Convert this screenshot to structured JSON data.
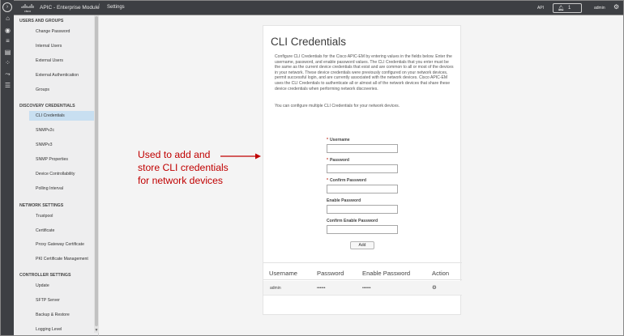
{
  "topbar": {
    "brand": "cisco",
    "app_title": "APIC - Enterprise Module",
    "separator": "/",
    "breadcrumb": "Settings",
    "api_label": "API",
    "notification_count": "1",
    "user": "admin",
    "icons": {
      "notifications": "bell-icon",
      "settings": "gear-icon"
    }
  },
  "rail": {
    "icons": [
      "home-icon",
      "circle-nodes-icon",
      "database-icon",
      "device-icon",
      "topology-icon",
      "path-trace-icon",
      "list-icon"
    ]
  },
  "nav": {
    "sections": [
      {
        "title": "USERS AND GROUPS",
        "items": [
          "Change Password",
          "Internal Users",
          "External Users",
          "External Authentication",
          "Groups"
        ]
      },
      {
        "title": "DISCOVERY CREDENTIALS",
        "items": [
          "CLI Credentials",
          "SNMPv2c",
          "SNMPv3",
          "SNMP Properties",
          "Device Controllability",
          "Polling Interval"
        ]
      },
      {
        "title": "NETWORK SETTINGS",
        "items": [
          "Trustpool",
          "Certificate",
          "Proxy Gateway Certificate",
          "PKI Certificate Management"
        ]
      },
      {
        "title": "CONTROLLER SETTINGS",
        "items": [
          "Update",
          "SFTP Server",
          "Backup & Restore",
          "Logging Level"
        ]
      }
    ],
    "active": "CLI Credentials"
  },
  "card": {
    "title": "CLI Credentials",
    "description": "Configure CLI Credentials for the Cisco APIC-EM by entering values in the fields below. Enter the username, password, and enable password values. The CLI Credentials that you enter must be the same as the current device credentials that exist and are common to all or most of the devices in your network. These device credentials were previously configured on your network devices, permit successful login, and are currently associated with the network devices. Cisco APIC-EM uses the CLI Credentials to authenticate all or almost all of the network devices that share these device credentials when performing network discoveries.",
    "description2": "You can configure multiple CLI Credentials for your network devices.",
    "form": {
      "required_marker": "*",
      "username_label": "Username",
      "password_label": "Password",
      "confirm_password_label": "Confirm Password",
      "enable_password_label": "Enable Password",
      "confirm_enable_password_label": "Confirm Enable Password",
      "add_button": "Add"
    },
    "table": {
      "headers": [
        "Username",
        "Password",
        "Enable Password",
        "Action"
      ],
      "rows": [
        {
          "username": "admin",
          "password": "••••••",
          "enable_password": "••••••",
          "action_icon": "gear-icon"
        }
      ]
    }
  },
  "annotation": {
    "lines": [
      "Used to add and",
      "store CLI credentials",
      "for network devices"
    ],
    "color": "#c00000"
  }
}
